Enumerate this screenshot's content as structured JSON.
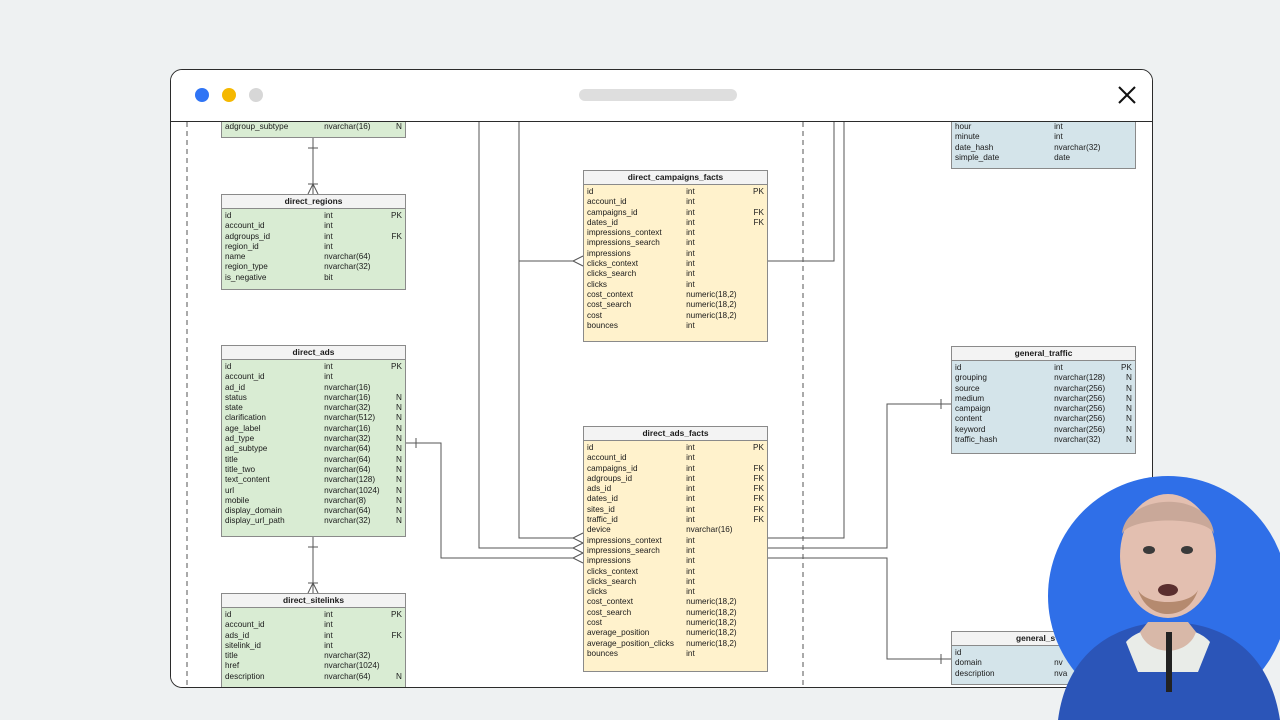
{
  "window": {
    "dots": [
      {
        "name": "blue-dot",
        "color": "#2f74f5"
      },
      {
        "name": "yellow-dot",
        "color": "#f5b800"
      },
      {
        "name": "gray-dot",
        "color": "#d7d7d7"
      }
    ]
  },
  "tables": {
    "adgroups_partial": {
      "rows": [
        {
          "n": "adgroup_subtype",
          "t": "nvarchar(16)",
          "k": "N"
        }
      ]
    },
    "direct_regions": {
      "title": "direct_regions",
      "rows": [
        {
          "n": "id",
          "t": "int",
          "k": "PK"
        },
        {
          "n": "account_id",
          "t": "int",
          "k": ""
        },
        {
          "n": "adgroups_id",
          "t": "int",
          "k": "FK"
        },
        {
          "n": "region_id",
          "t": "int",
          "k": ""
        },
        {
          "n": "name",
          "t": "nvarchar(64)",
          "k": ""
        },
        {
          "n": "region_type",
          "t": "nvarchar(32)",
          "k": ""
        },
        {
          "n": "is_negative",
          "t": "bit",
          "k": ""
        }
      ]
    },
    "direct_ads": {
      "title": "direct_ads",
      "rows": [
        {
          "n": "id",
          "t": "int",
          "k": "PK"
        },
        {
          "n": "account_id",
          "t": "int",
          "k": ""
        },
        {
          "n": "ad_id",
          "t": "nvarchar(16)",
          "k": ""
        },
        {
          "n": "status",
          "t": "nvarchar(16)",
          "k": "N"
        },
        {
          "n": "state",
          "t": "nvarchar(32)",
          "k": "N"
        },
        {
          "n": "clarification",
          "t": "nvarchar(512)",
          "k": "N"
        },
        {
          "n": "age_label",
          "t": "nvarchar(16)",
          "k": "N"
        },
        {
          "n": "ad_type",
          "t": "nvarchar(32)",
          "k": "N"
        },
        {
          "n": "ad_subtype",
          "t": "nvarchar(64)",
          "k": "N"
        },
        {
          "n": "title",
          "t": "nvarchar(64)",
          "k": "N"
        },
        {
          "n": "title_two",
          "t": "nvarchar(64)",
          "k": "N"
        },
        {
          "n": "text_content",
          "t": "nvarchar(128)",
          "k": "N"
        },
        {
          "n": "url",
          "t": "nvarchar(1024)",
          "k": "N"
        },
        {
          "n": "mobile",
          "t": "nvarchar(8)",
          "k": "N"
        },
        {
          "n": "display_domain",
          "t": "nvarchar(64)",
          "k": "N"
        },
        {
          "n": "display_url_path",
          "t": "nvarchar(32)",
          "k": "N"
        }
      ]
    },
    "direct_sitelinks": {
      "title": "direct_sitelinks",
      "rows": [
        {
          "n": "id",
          "t": "int",
          "k": "PK"
        },
        {
          "n": "account_id",
          "t": "int",
          "k": ""
        },
        {
          "n": "ads_id",
          "t": "int",
          "k": "FK"
        },
        {
          "n": "sitelink_id",
          "t": "int",
          "k": ""
        },
        {
          "n": "title",
          "t": "nvarchar(32)",
          "k": ""
        },
        {
          "n": "href",
          "t": "nvarchar(1024)",
          "k": ""
        },
        {
          "n": "description",
          "t": "nvarchar(64)",
          "k": "N"
        }
      ]
    },
    "direct_campaigns_facts": {
      "title": "direct_campaigns_facts",
      "rows": [
        {
          "n": "id",
          "t": "int",
          "k": "PK"
        },
        {
          "n": "account_id",
          "t": "int",
          "k": ""
        },
        {
          "n": "campaigns_id",
          "t": "int",
          "k": "FK"
        },
        {
          "n": "dates_id",
          "t": "int",
          "k": "FK"
        },
        {
          "n": "impressions_context",
          "t": "int",
          "k": ""
        },
        {
          "n": "impressions_search",
          "t": "int",
          "k": ""
        },
        {
          "n": "impressions",
          "t": "int",
          "k": ""
        },
        {
          "n": "clicks_context",
          "t": "int",
          "k": ""
        },
        {
          "n": "clicks_search",
          "t": "int",
          "k": ""
        },
        {
          "n": "clicks",
          "t": "int",
          "k": ""
        },
        {
          "n": "cost_context",
          "t": "numeric(18,2)",
          "k": ""
        },
        {
          "n": "cost_search",
          "t": "numeric(18,2)",
          "k": ""
        },
        {
          "n": "cost",
          "t": "numeric(18,2)",
          "k": ""
        },
        {
          "n": "bounces",
          "t": "int",
          "k": ""
        }
      ]
    },
    "direct_ads_facts": {
      "title": "direct_ads_facts",
      "rows": [
        {
          "n": "id",
          "t": "int",
          "k": "PK"
        },
        {
          "n": "account_id",
          "t": "int",
          "k": ""
        },
        {
          "n": "campaigns_id",
          "t": "int",
          "k": "FK"
        },
        {
          "n": "adgroups_id",
          "t": "int",
          "k": "FK"
        },
        {
          "n": "ads_id",
          "t": "int",
          "k": "FK"
        },
        {
          "n": "dates_id",
          "t": "int",
          "k": "FK"
        },
        {
          "n": "sites_id",
          "t": "int",
          "k": "FK"
        },
        {
          "n": "traffic_id",
          "t": "int",
          "k": "FK"
        },
        {
          "n": "device",
          "t": "nvarchar(16)",
          "k": ""
        },
        {
          "n": "impressions_context",
          "t": "int",
          "k": ""
        },
        {
          "n": "impressions_search",
          "t": "int",
          "k": ""
        },
        {
          "n": "impressions",
          "t": "int",
          "k": ""
        },
        {
          "n": "clicks_context",
          "t": "int",
          "k": ""
        },
        {
          "n": "clicks_search",
          "t": "int",
          "k": ""
        },
        {
          "n": "clicks",
          "t": "int",
          "k": ""
        },
        {
          "n": "cost_context",
          "t": "numeric(18,2)",
          "k": ""
        },
        {
          "n": "cost_search",
          "t": "numeric(18,2)",
          "k": ""
        },
        {
          "n": "cost",
          "t": "numeric(18,2)",
          "k": ""
        },
        {
          "n": "average_position",
          "t": "numeric(18,2)",
          "k": ""
        },
        {
          "n": "average_position_clicks",
          "t": "numeric(18,2)",
          "k": ""
        },
        {
          "n": "bounces",
          "t": "int",
          "k": ""
        }
      ]
    },
    "dates_partial": {
      "rows": [
        {
          "n": "hour",
          "t": "int",
          "k": ""
        },
        {
          "n": "minute",
          "t": "int",
          "k": ""
        },
        {
          "n": "date_hash",
          "t": "nvarchar(32)",
          "k": ""
        },
        {
          "n": "simple_date",
          "t": "date",
          "k": ""
        }
      ]
    },
    "general_traffic": {
      "title": "general_traffic",
      "rows": [
        {
          "n": "id",
          "t": "int",
          "k": "PK"
        },
        {
          "n": "grouping",
          "t": "nvarchar(128)",
          "k": "N"
        },
        {
          "n": "source",
          "t": "nvarchar(256)",
          "k": "N"
        },
        {
          "n": "medium",
          "t": "nvarchar(256)",
          "k": "N"
        },
        {
          "n": "campaign",
          "t": "nvarchar(256)",
          "k": "N"
        },
        {
          "n": "content",
          "t": "nvarchar(256)",
          "k": "N"
        },
        {
          "n": "keyword",
          "t": "nvarchar(256)",
          "k": "N"
        },
        {
          "n": "traffic_hash",
          "t": "nvarchar(32)",
          "k": "N"
        }
      ]
    },
    "general_sites": {
      "title": "general_s",
      "rows": [
        {
          "n": "id",
          "t": "",
          "k": ""
        },
        {
          "n": "domain",
          "t": "nv",
          "k": ""
        },
        {
          "n": "description",
          "t": "nva",
          "k": ""
        }
      ]
    }
  }
}
